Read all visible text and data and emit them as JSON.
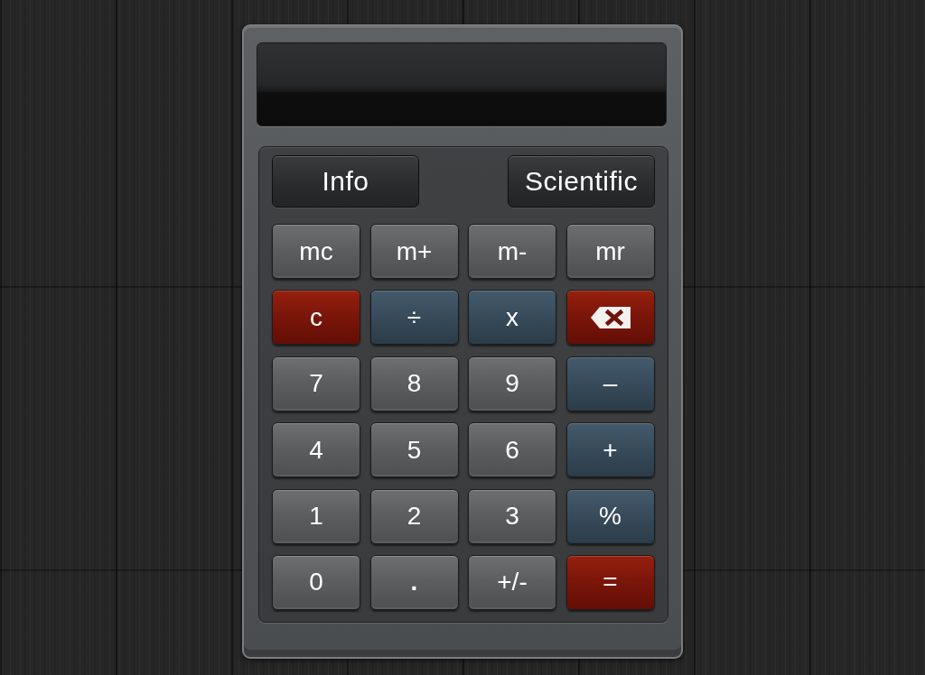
{
  "calculator": {
    "top_buttons": [
      {
        "label": "Info"
      },
      {
        "label": "Scientific"
      }
    ],
    "keys": [
      [
        {
          "label": "mc",
          "kind": "memory"
        },
        {
          "label": "m+",
          "kind": "memory"
        },
        {
          "label": "m-",
          "kind": "memory"
        },
        {
          "label": "mr",
          "kind": "memory"
        }
      ],
      [
        {
          "label": "c",
          "kind": "clear"
        },
        {
          "label": "÷",
          "kind": "operator"
        },
        {
          "label": "x",
          "kind": "operator"
        },
        {
          "kind": "delete"
        }
      ],
      [
        {
          "label": "7",
          "kind": "number"
        },
        {
          "label": "8",
          "kind": "number"
        },
        {
          "label": "9",
          "kind": "number"
        },
        {
          "label": "–",
          "kind": "operator"
        }
      ],
      [
        {
          "label": "4",
          "kind": "number"
        },
        {
          "label": "5",
          "kind": "number"
        },
        {
          "label": "6",
          "kind": "number"
        },
        {
          "label": "+",
          "kind": "operator"
        }
      ],
      [
        {
          "label": "1",
          "kind": "number"
        },
        {
          "label": "2",
          "kind": "number"
        },
        {
          "label": "3",
          "kind": "number"
        },
        {
          "label": "%",
          "kind": "operator"
        }
      ],
      [
        {
          "label": "0",
          "kind": "number"
        },
        {
          "label": ".",
          "kind": "decimal"
        },
        {
          "label": "+/-",
          "kind": "sign"
        },
        {
          "label": "=",
          "kind": "equals"
        }
      ]
    ]
  }
}
